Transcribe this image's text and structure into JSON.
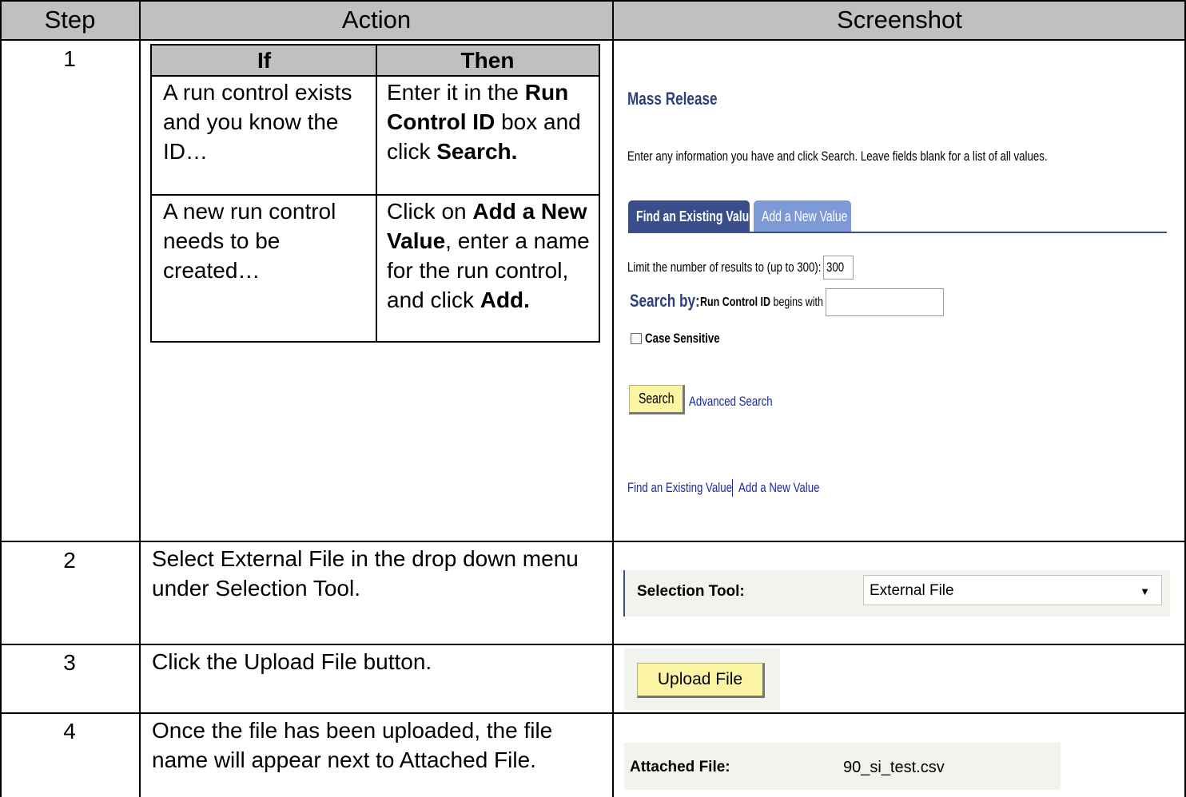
{
  "table": {
    "headers": {
      "step": "Step",
      "action": "Action",
      "screenshot": "Screenshot"
    },
    "rows": [
      {
        "step": "1"
      },
      {
        "step": "2",
        "action": "Select External File in the drop down menu under Selection Tool."
      },
      {
        "step": "3",
        "action": "Click the Upload File button."
      },
      {
        "step": "4",
        "action": "Once the file has been uploaded, the file name will appear next to Attached File."
      }
    ]
  },
  "if_then": {
    "col_if": "If",
    "col_then": "Then",
    "row1": {
      "if": "A run control exists and you know the ID…",
      "then_pre": "Enter it in the",
      "then_bold1": "Run Control ID",
      "then_mid": "box and click",
      "then_bold2": "Search."
    },
    "row2": {
      "if": "A new run control needs to be created…",
      "then_pre": "Click on",
      "then_bold1": "Add a New Value",
      "then_mid": ", enter a name for the run control, and click",
      "then_bold2": "Add."
    }
  },
  "mass_release": {
    "title": "Mass Release",
    "instructions": "Enter any information you have and click Search. Leave fields blank for a list of all values.",
    "tab_find": "Find an Existing Value",
    "tab_add": "Add a New Value",
    "limit_label": "Limit the number of results to (up to 300):",
    "limit_value": "300",
    "search_by": "Search by:",
    "field_label": "Run Control ID",
    "begins_with": "begins with",
    "run_control_value": "",
    "case_sensitive": "Case Sensitive",
    "search_button": "Search",
    "advanced_search": "Advanced Search",
    "footer_find": "Find an Existing Value",
    "footer_add": "Add a New Value"
  },
  "selection_tool": {
    "label": "Selection Tool:",
    "value": "External File"
  },
  "upload": {
    "button": "Upload File"
  },
  "attached": {
    "label": "Attached File:",
    "file": "90_si_test.csv"
  },
  "colors": {
    "header_bg": "#c0c0c0",
    "tab_active": "#3a4e8c",
    "tab_inactive": "#7d9ad6",
    "button_bg": "#fbf4a2",
    "link": "#1c2aa6",
    "panel_bg": "#f3f3ee"
  }
}
